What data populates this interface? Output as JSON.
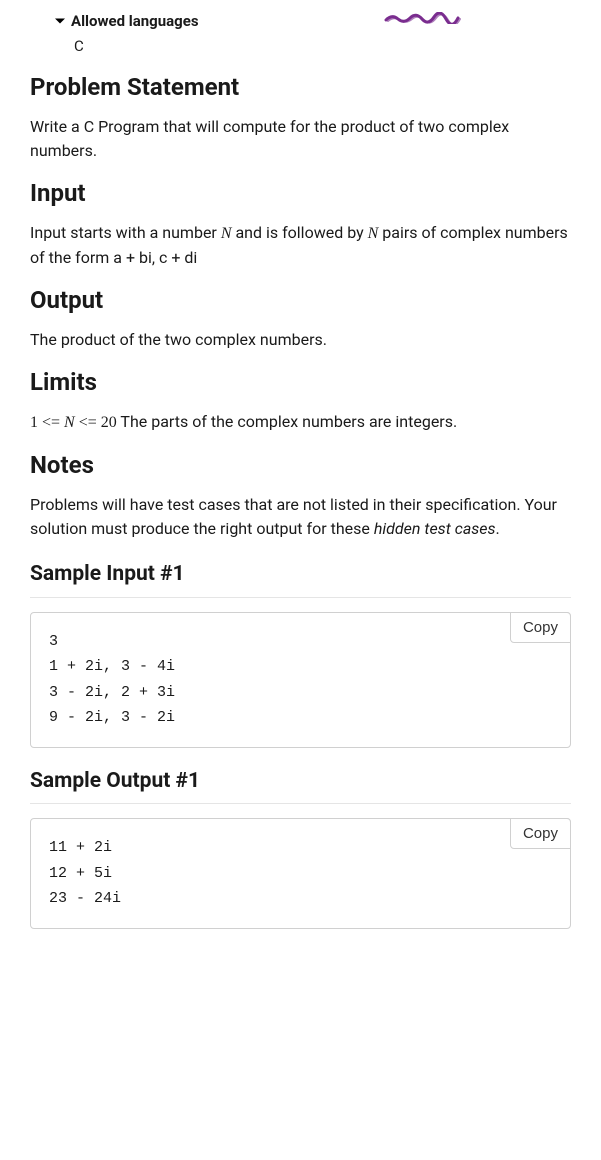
{
  "allowed": {
    "label": "Allowed languages",
    "language": "C"
  },
  "sections": {
    "problem_statement": {
      "heading": "Problem Statement",
      "text": "Write a C Program that will compute for the product of two complex numbers."
    },
    "input": {
      "heading": "Input",
      "text_pre": "Input starts with a number ",
      "N1": "N",
      "text_mid": " and is followed by ",
      "N2": "N",
      "text_post": " pairs of complex numbers of the form a + bi, c + di"
    },
    "output": {
      "heading": "Output",
      "text": "The product of the two complex numbers."
    },
    "limits": {
      "heading": "Limits",
      "math": "1 <= N <= 20",
      "text": " The parts of the complex numbers are integers."
    },
    "notes": {
      "heading": "Notes",
      "text_pre": "Problems will have test cases that are not listed in their specification. Your solution must produce the right output for these ",
      "italic": "hidden test cases",
      "text_post": "."
    },
    "sample_input": {
      "heading": "Sample Input #1",
      "copy": "Copy",
      "code": "3\n1 + 2i, 3 - 4i\n3 - 2i, 2 + 3i\n9 - 2i, 3 - 2i"
    },
    "sample_output": {
      "heading": "Sample Output #1",
      "copy": "Copy",
      "code": "11 + 2i\n12 + 5i\n23 - 24i"
    }
  }
}
